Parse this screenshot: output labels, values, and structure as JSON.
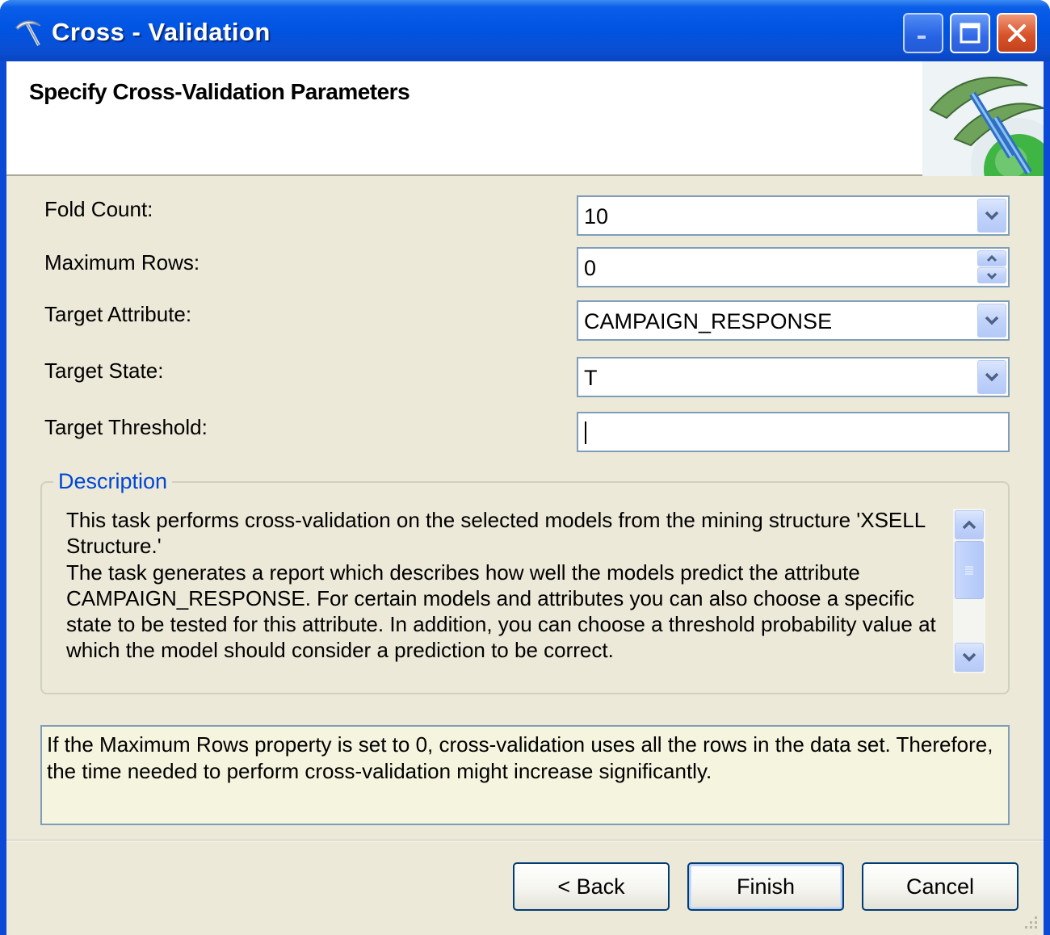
{
  "window": {
    "title": "Cross - Validation"
  },
  "header": {
    "title": "Specify Cross-Validation Parameters"
  },
  "form": {
    "fold_count": {
      "label": "Fold Count:",
      "value": "10"
    },
    "maximum_rows": {
      "label": "Maximum Rows:",
      "value": "0"
    },
    "target_attribute": {
      "label": "Target Attribute:",
      "value": "CAMPAIGN_RESPONSE"
    },
    "target_state": {
      "label": "Target State:",
      "value": "T"
    },
    "target_threshold": {
      "label": "Target Threshold:",
      "value": ""
    }
  },
  "description": {
    "legend": "Description",
    "paragraphs": [
      "This task performs cross-validation on the selected models from the mining structure 'XSELL Structure.'",
      "The task generates a report which describes how well the models predict the attribute CAMPAIGN_RESPONSE.  For certain models and attributes you can also choose a specific state to be tested for this attribute. In addition, you can choose a threshold probability value at which the model should consider a prediction to be correct."
    ]
  },
  "info": {
    "text": "If the Maximum Rows property is set to 0, cross-validation uses all the rows in the data set. Therefore, the time needed to perform cross-validation might increase significantly."
  },
  "buttons": {
    "back": "< Back",
    "finish": "Finish",
    "cancel": "Cancel"
  }
}
